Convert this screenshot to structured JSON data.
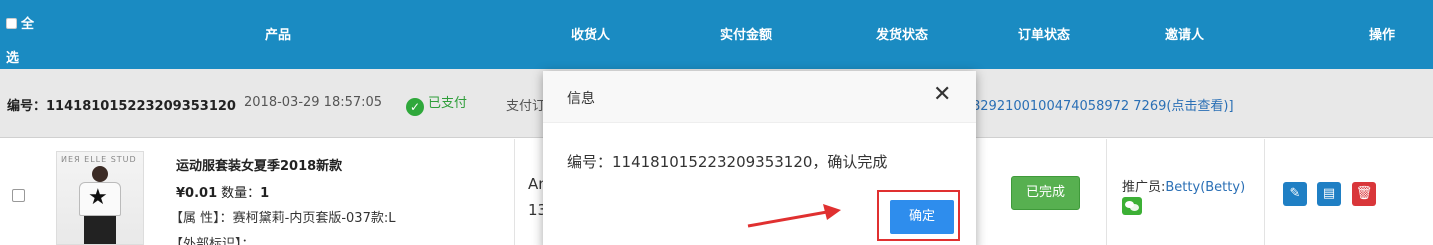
{
  "table_header": {
    "select_all_top": "全",
    "select_all_bottom": "选",
    "product": "产品",
    "receiver": "收货人",
    "paid_amount": "实付金额",
    "ship_status": "发货状态",
    "order_status": "订单状态",
    "inviter": "邀请人",
    "actions": "操作"
  },
  "order": {
    "number_label": "编号：",
    "number": "114181015223209353120",
    "datetime": "2018-03-29 18:57:05",
    "paid_status": "已支付",
    "pay_prefix": "支付订",
    "trade_ref": "8292100100474058972 7269(点击查看)]"
  },
  "product": {
    "name": "运动服套装女夏季2018新款",
    "price": "¥0.01",
    "qty_label": "数量：",
    "qty": "1",
    "attr_label": "【属 性】：",
    "attr_value": "赛柯黛莉-内页套版-037款:L",
    "ext_label": "【外部标识】：",
    "thumb_brand": "ИЕЯ ELLE STUD"
  },
  "receiver": {
    "line1": "An",
    "line2": "13"
  },
  "order_status_button": "已完成",
  "promoter": {
    "label": "推广员:",
    "value": "Betty(Betty)"
  },
  "icons": {
    "edit": "edit-icon",
    "view": "view-icon",
    "delete": "delete-icon",
    "wechat": "wechat-icon",
    "close": "close-icon",
    "check": "check-circle-icon"
  },
  "dialog": {
    "title": "信息",
    "close": "✕",
    "message": "编号：114181015223209353120，确认完成",
    "confirm": "确定"
  },
  "colors": {
    "header": "#1a8bc2",
    "confirm": "#2e8ded",
    "done": "#57b050",
    "delete": "#d9363a",
    "annotation": "#e03030"
  }
}
